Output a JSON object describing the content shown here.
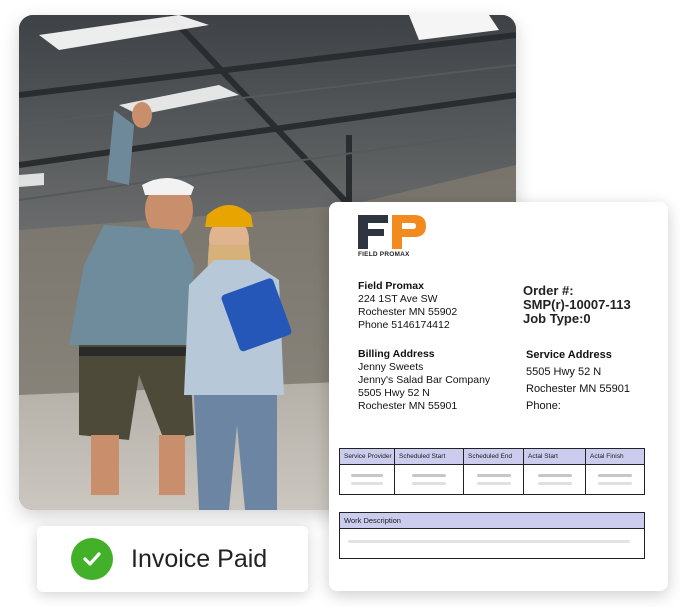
{
  "badge": {
    "label": "Invoice Paid",
    "icon": "check-icon",
    "color": "#43b02a"
  },
  "document": {
    "logo": {
      "letters": "FP",
      "name": "FIELD PROMAX",
      "dark": "#2e3440",
      "accent": "#f28a1e"
    },
    "company": {
      "name": "Field Promax",
      "street": "224 1ST Ave SW",
      "city": "Rochester MN 55902",
      "phone": "Phone 5146174412"
    },
    "order": {
      "order_label": "Order #:",
      "order_number": "SMP(r)-10007-113",
      "job_type": "Job Type:0"
    },
    "billing": {
      "heading": "Billing Address",
      "name": "Jenny Sweets",
      "company": "Jenny's Salad Bar Company",
      "street": "5505 Hwy 52 N",
      "city": "Rochester MN 55901"
    },
    "service": {
      "heading": "Service Address",
      "street": "5505 Hwy 52 N",
      "city": "Rochester MN 55901",
      "phone": "Phone:"
    },
    "schedule_table": {
      "headers": [
        "Service Provider",
        "Scheduled Start",
        "Scheduled End",
        "Actal Start",
        "Actal Finish"
      ]
    },
    "work_description": {
      "header": "Work Description"
    }
  }
}
